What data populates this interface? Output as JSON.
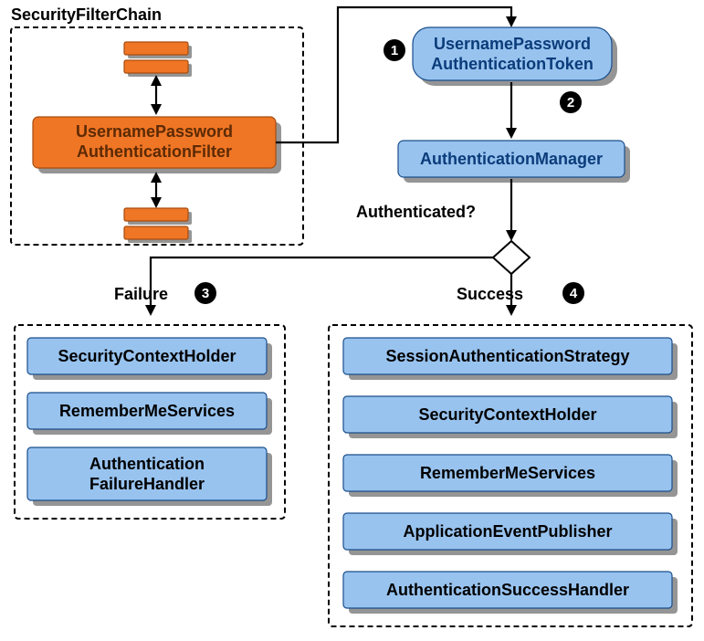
{
  "diagram": {
    "title": "SecurityFilterChain",
    "filter_chain_label": "SecurityFilterChain",
    "filter_box_line1": "UsernamePassword",
    "filter_box_line2": "AuthenticationFilter",
    "token_line1": "UsernamePassword",
    "token_line2": "AuthenticationToken",
    "auth_manager": "AuthenticationManager",
    "decision_label": "Authenticated?",
    "failure_label": "Failure",
    "success_label": "Success",
    "badges": {
      "one": "1",
      "two": "2",
      "three": "3",
      "four": "4"
    },
    "failure_boxes": [
      "SecurityContextHolder",
      "RememberMeServices"
    ],
    "failure_multiline": {
      "line1": "Authentication",
      "line2": "FailureHandler"
    },
    "success_boxes": [
      "SessionAuthenticationStrategy",
      "SecurityContextHolder",
      "RememberMeServices",
      "ApplicationEventPublisher",
      "AuthenticationSuccessHandler"
    ]
  }
}
